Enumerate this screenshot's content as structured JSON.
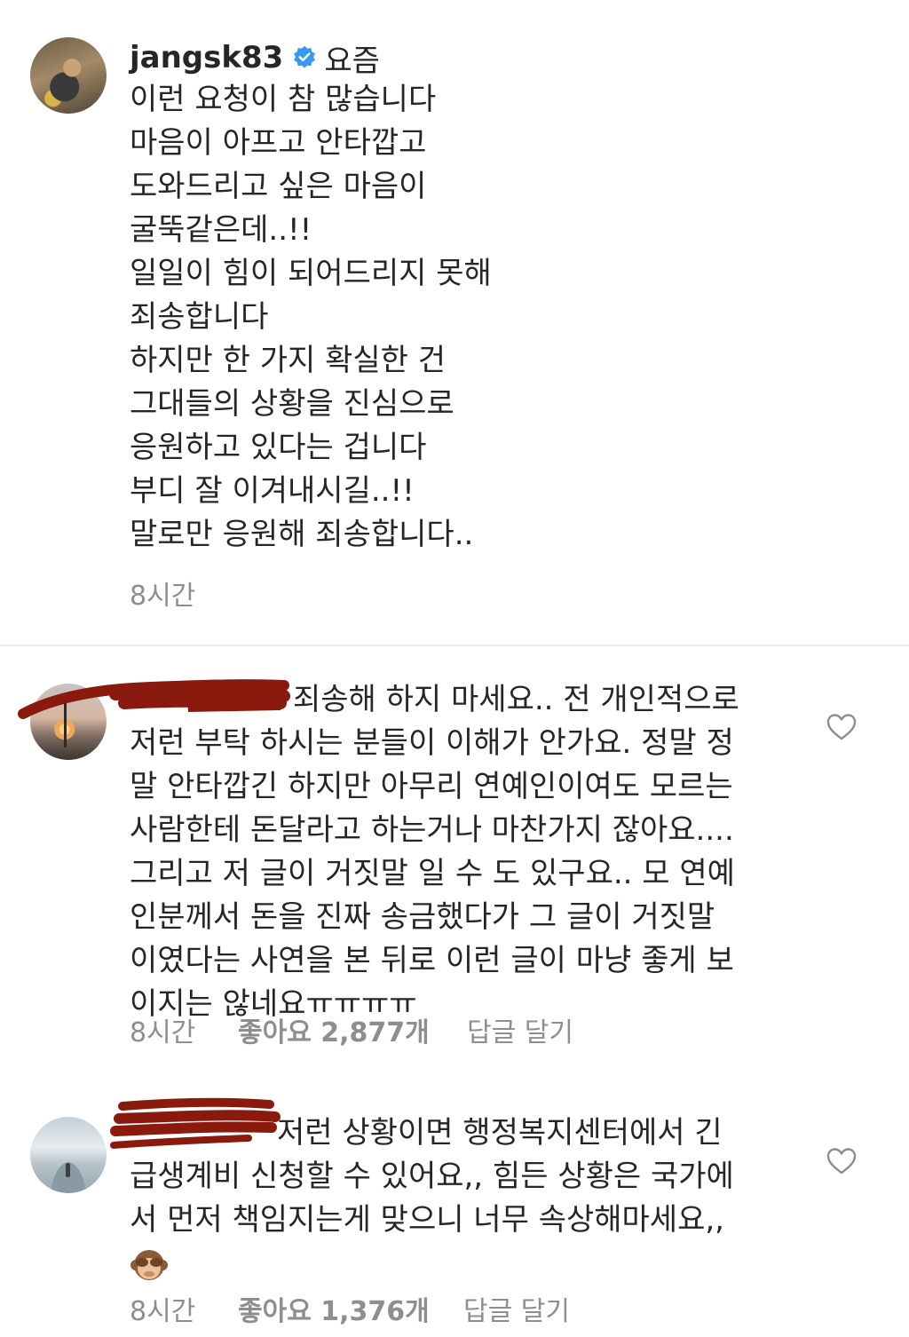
{
  "post": {
    "username": "jangsk83",
    "time_label": "요즘",
    "lines": [
      "이런 요청이 참 많습니다",
      "마음이 아프고 안타깝고",
      "도와드리고 싶은 마음이",
      "굴뚝같은데..!!",
      "일일이 힘이 되어드리지 못해",
      "죄송합니다",
      "하지만 한 가지 확실한 건",
      "그대들의 상황을 진심으로",
      "응원하고 있다는 겁니다",
      "부디 잘 이겨내시길..!!",
      "말로만 응원해 죄송합니다.."
    ],
    "time": "8시간"
  },
  "comments": [
    {
      "lines": [
        "죄송해 하지 마세요.. 전 개인적으로",
        "저런 부탁 하시는 분들이 이해가 안가요. 정말 정",
        "말 안타깝긴 하지만 아무리 연예인이여도 모르는",
        "사람한테 돈달라고 하는거나 마찬가지 잖아요....",
        "그리고 저 글이 거짓말 일 수 도 있구요.. 모 연예",
        "인분께서 돈을 진짜 송금했다가 그 글이 거짓말",
        "이였다는 사연을 본 뒤로 이런 글이 마냥 좋게 보",
        "이지는 않네요ㅠㅠㅠㅠ"
      ],
      "time": "8시간",
      "likes": "좋아요 2,877개",
      "reply": "답글 달기"
    },
    {
      "lines": [
        "저런 상황이면 행정복지센터에서 긴",
        "급생계비 신청할 수 있어요,, 힘든 상황은 국가에",
        "서 먼저 책임지는게 맞으니 너무 속상해마세요,,"
      ],
      "emoji": "see-no-evil-monkey",
      "time": "8시간",
      "likes": "좋아요 1,376개",
      "reply": "답글 달기"
    }
  ],
  "colors": {
    "text": "#262626",
    "meta": "#8e8e8e",
    "verified": "#3897f0",
    "redaction": "#8b1a0e",
    "divider": "#e9e9e9"
  }
}
